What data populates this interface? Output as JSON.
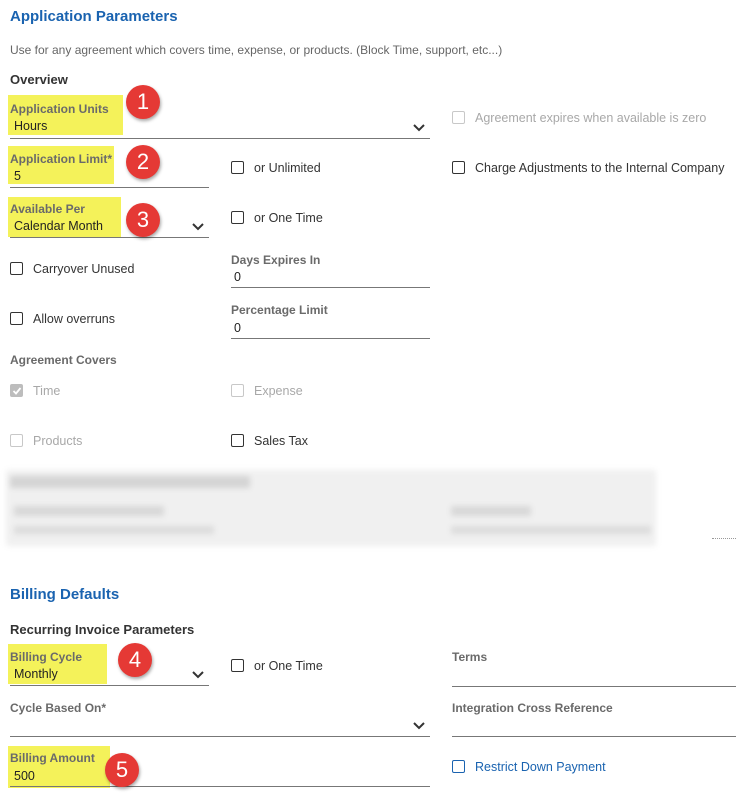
{
  "app_params": {
    "title": "Application Parameters",
    "description": "Use for any agreement which covers time, expense, or products. (Block Time, support, etc...)",
    "overview_label": "Overview",
    "application_units": {
      "label": "Application Units",
      "value": "Hours"
    },
    "expires_zero": {
      "label": "Agreement expires when available is zero",
      "checked": false,
      "disabled": true
    },
    "application_limit": {
      "label": "Application Limit*",
      "value": "5"
    },
    "unlimited": {
      "label": "or Unlimited",
      "checked": false
    },
    "charge_adjustments": {
      "label": "Charge Adjustments to the Internal Company",
      "checked": false
    },
    "available_per": {
      "label": "Available Per",
      "value": "Calendar Month"
    },
    "one_time": {
      "label": "or One Time",
      "checked": false
    },
    "carryover": {
      "label": "Carryover Unused",
      "checked": false
    },
    "days_expires": {
      "label": "Days Expires In",
      "value": "0"
    },
    "allow_overruns": {
      "label": "Allow overruns",
      "checked": false
    },
    "percentage_limit": {
      "label": "Percentage Limit",
      "value": "0"
    },
    "agreement_covers_label": "Agreement Covers",
    "covers": {
      "time": {
        "label": "Time",
        "checked": true,
        "disabled": true
      },
      "expense": {
        "label": "Expense",
        "checked": false,
        "disabled": true
      },
      "products": {
        "label": "Products",
        "checked": false,
        "disabled": true
      },
      "sales_tax": {
        "label": "Sales Tax",
        "checked": false
      }
    }
  },
  "billing": {
    "title": "Billing Defaults",
    "recurring_label": "Recurring Invoice Parameters",
    "billing_cycle": {
      "label": "Billing Cycle",
      "value": "Monthly"
    },
    "one_time": {
      "label": "or One Time",
      "checked": false
    },
    "terms": {
      "label": "Terms",
      "value": ""
    },
    "cycle_based_on": {
      "label": "Cycle Based On*",
      "value": ""
    },
    "integration_xref": {
      "label": "Integration Cross Reference",
      "value": ""
    },
    "billing_amount": {
      "label": "Billing Amount",
      "value": "500"
    },
    "restrict_down_payment": {
      "label": "Restrict Down Payment",
      "checked": false
    }
  },
  "callouts": [
    "1",
    "2",
    "3",
    "4",
    "5"
  ],
  "colors": {
    "accent": "#1a63b0",
    "highlight": "#f4f25a",
    "callout": "#e53935"
  }
}
